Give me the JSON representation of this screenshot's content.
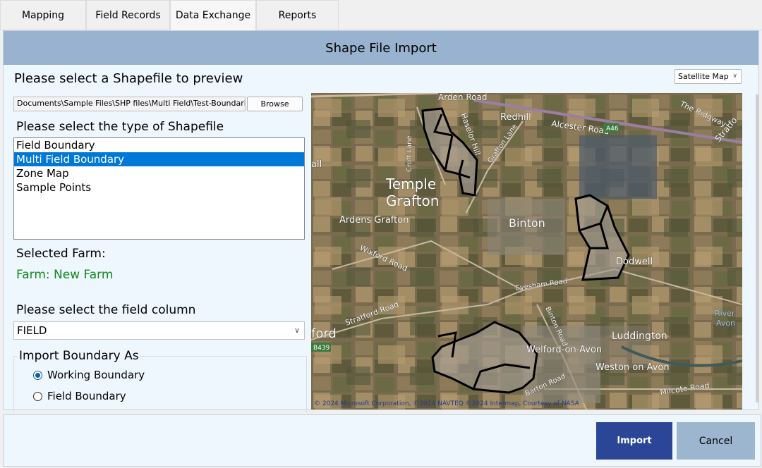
{
  "tabs": [
    {
      "label": "Mapping"
    },
    {
      "label": "Field Records"
    },
    {
      "label": "Data Exchange",
      "active": true
    },
    {
      "label": "Reports"
    }
  ],
  "panel": {
    "title": "Shape File Import",
    "select_prompt": "Please select a Shapefile to preview",
    "file_path": "Documents\\Sample Files\\SHP files\\Multi Field\\Test-Boundaries.shp",
    "browse_label": "Browse",
    "type_prompt": "Please select the type of Shapefile",
    "types": [
      {
        "label": "Field Boundary"
      },
      {
        "label": "Multi Field Boundary",
        "selected": true
      },
      {
        "label": "Zone Map"
      },
      {
        "label": "Sample Points"
      }
    ],
    "selected_farm_label": "Selected Farm:",
    "farm_value": "Farm: New Farm",
    "field_column_prompt": "Please select the field column",
    "field_column_value": "FIELD",
    "import_as_label": "Import Boundary As",
    "import_options": [
      {
        "label": "Working Boundary",
        "checked": true
      },
      {
        "label": "Field Boundary",
        "checked": false
      }
    ]
  },
  "map": {
    "layer_selected": "Satellite Map",
    "labels": {
      "arden_road": "Arden Road",
      "redhill": "Redhill",
      "alcester_road": "Alcester Road",
      "a46": "A46",
      "the_ridgway": "The Ridgway",
      "stratford": "Stratfo",
      "haselor_hill": "Haselor Hill",
      "croft_lane": "Croft Lane",
      "grafton_lane": "Grafton Lane",
      "temple": "Temple",
      "grafton": "Grafton",
      "all": "all",
      "ardens_grafton": "Ardens Grafton",
      "binton": "Binton",
      "wixford_road": "Wixford Road",
      "dodwell": "Dodwell",
      "evesham_road": "Evesham Road",
      "binton_road": "Binton Road",
      "stratford_road": "Stratford Road",
      "ford": "ford",
      "b439": "B439",
      "welford": "Welford-on-Avon",
      "luddington": "Luddington",
      "river_avon_1": "River",
      "river_avon_2": "Avon",
      "weston": "Weston on Avon",
      "milcote_road": "Milcote Road",
      "barton_road": "Barton Road",
      "copyright": "© 2024 Microsoft Corporation, ©2024 NAVTEQ ©2024 Intermap, Courtesy of NASA"
    }
  },
  "footer": {
    "import_label": "Import",
    "cancel_label": "Cancel"
  },
  "colors": {
    "header_bg": "#98b2cf",
    "panel_bg": "#eef6fe",
    "import_bg": "#2b4696",
    "cancel_bg": "#9cb6cf",
    "selected_item": "#0078d7",
    "farm_text": "#12891a"
  }
}
